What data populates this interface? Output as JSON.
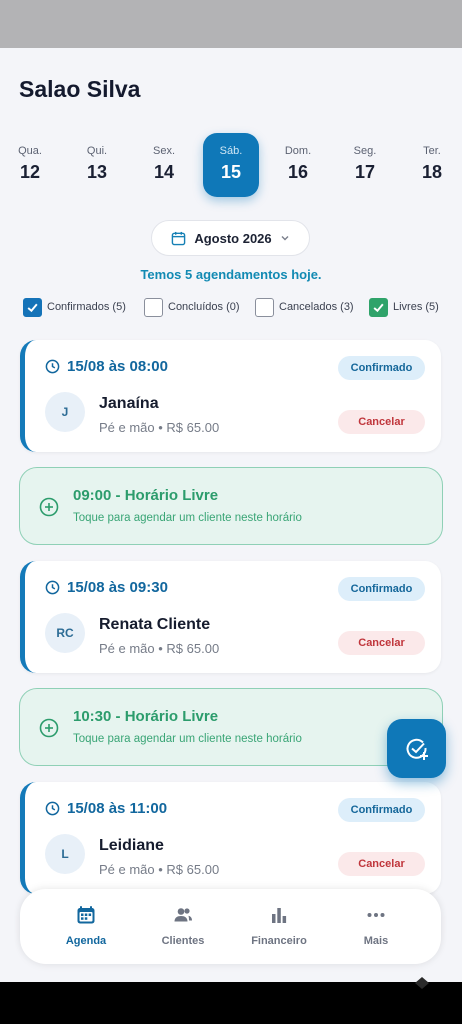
{
  "app": {
    "title": "Salao Silva"
  },
  "days": [
    {
      "weekday": "Qua.",
      "day": "12",
      "selected": false
    },
    {
      "weekday": "Qui.",
      "day": "13",
      "selected": false
    },
    {
      "weekday": "Sex.",
      "day": "14",
      "selected": false
    },
    {
      "weekday": "Sáb.",
      "day": "15",
      "selected": true
    },
    {
      "weekday": "Dom.",
      "day": "16",
      "selected": false
    },
    {
      "weekday": "Seg.",
      "day": "17",
      "selected": false
    },
    {
      "weekday": "Ter.",
      "day": "18",
      "selected": false
    }
  ],
  "month": {
    "label": "Agosto 2026"
  },
  "summary": "Temos 5 agendamentos hoje.",
  "filters": [
    {
      "label": "Confirmados (5)",
      "checked": true,
      "color": "#1573b8"
    },
    {
      "label": "Concluídos (0)",
      "checked": false
    },
    {
      "label": "Cancelados (3)",
      "checked": false
    },
    {
      "label": "Livres (5)",
      "checked": true,
      "color": "#2fa36a"
    }
  ],
  "appointments": [
    {
      "time": "15/08 às 08:00",
      "status": "Confirmado",
      "initials": "J",
      "name": "Janaína",
      "service": "Pé e mão • R$ 65.00",
      "cancel": "Cancelar"
    },
    {
      "time": "15/08 às 09:30",
      "status": "Confirmado",
      "initials": "RC",
      "name": "Renata Cliente",
      "service": "Pé e mão • R$ 65.00",
      "cancel": "Cancelar"
    },
    {
      "time": "15/08 às 11:00",
      "status": "Confirmado",
      "initials": "L",
      "name": "Leidiane",
      "service": "Pé e mão • R$ 65.00",
      "cancel": "Cancelar"
    }
  ],
  "free_slots": [
    {
      "title": "09:00 - Horário Livre",
      "subtitle": "Toque para agendar um cliente neste horário"
    },
    {
      "title": "10:30 - Horário Livre",
      "subtitle": "Toque para agendar um cliente neste horário"
    }
  ],
  "nav": [
    {
      "label": "Agenda",
      "icon": "calendar-icon",
      "active": true
    },
    {
      "label": "Clientes",
      "icon": "users-icon",
      "active": false
    },
    {
      "label": "Financeiro",
      "icon": "bar-chart-icon",
      "active": false
    },
    {
      "label": "Mais",
      "icon": "more-icon",
      "active": false
    }
  ],
  "colors": {
    "primary": "#0f78b8",
    "free": "#2c9c6c",
    "danger": "#c0363c"
  }
}
